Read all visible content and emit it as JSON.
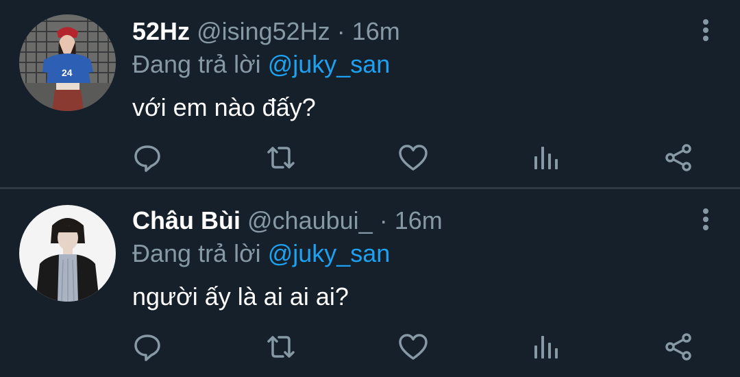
{
  "theme": {
    "background": "#15202b",
    "divider": "#2f3a45",
    "primary_text": "#ffffff",
    "secondary_text": "#8899a6",
    "link": "#1da1f2"
  },
  "tweets": [
    {
      "display_name": "52Hz",
      "handle": "@ising52Hz",
      "separator": "·",
      "time": "16m",
      "reply_prefix": "Đang trả lời",
      "reply_to": "@juky_san",
      "text": "với em nào đấy?"
    },
    {
      "display_name": "Châu Bùi",
      "handle": "@chaubui_",
      "separator": "·",
      "time": "16m",
      "reply_prefix": "Đang trả lời",
      "reply_to": "@juky_san",
      "text": "người ấy là ai ai ai?"
    }
  ],
  "actions": {
    "icons": [
      "reply-icon",
      "retweet-icon",
      "like-icon",
      "analytics-icon",
      "share-icon"
    ]
  }
}
